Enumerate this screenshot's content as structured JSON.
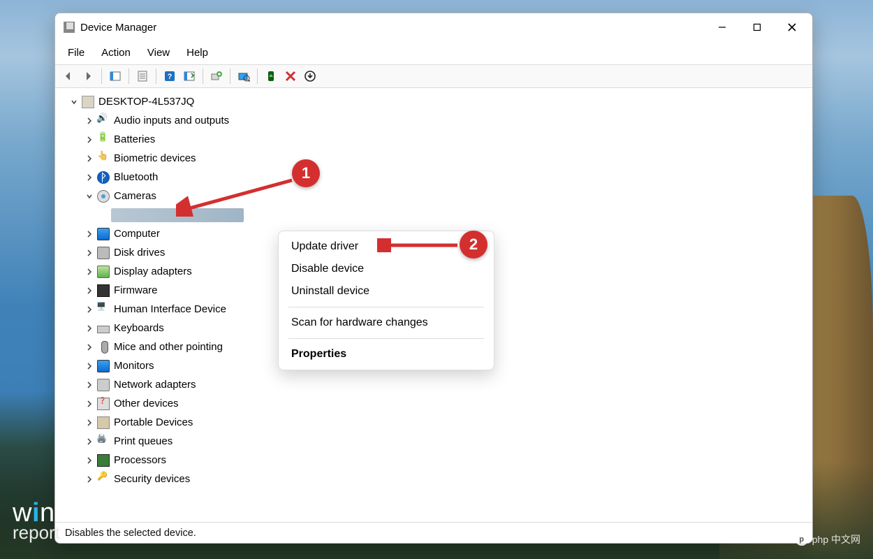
{
  "window": {
    "title": "Device Manager"
  },
  "window_controls": {
    "minimize": "Minimize",
    "maximize": "Maximize",
    "close": "Close"
  },
  "menubar": {
    "file": "File",
    "action": "Action",
    "view": "View",
    "help": "Help"
  },
  "toolbar": {
    "back": "Back",
    "forward": "Forward",
    "show_hidden": "Show hidden devices",
    "properties": "Properties",
    "help": "Help",
    "update": "Update driver",
    "uninstall_soft": "Add legacy hardware",
    "scan": "Scan for hardware changes",
    "enable": "Enable device",
    "disable": "Disable device",
    "uninstall": "Uninstall device"
  },
  "root": {
    "name": "DESKTOP-4L537JQ"
  },
  "categories": [
    {
      "label": "Audio inputs and outputs",
      "icon": "audio",
      "expanded": false
    },
    {
      "label": "Batteries",
      "icon": "battery",
      "expanded": false
    },
    {
      "label": "Biometric devices",
      "icon": "finger",
      "expanded": false
    },
    {
      "label": "Bluetooth",
      "icon": "bt",
      "expanded": false
    },
    {
      "label": "Cameras",
      "icon": "cam",
      "expanded": true
    },
    {
      "label": "Computer",
      "icon": "computer",
      "expanded": false
    },
    {
      "label": "Disk drives",
      "icon": "disk",
      "expanded": false
    },
    {
      "label": "Display adapters",
      "icon": "display",
      "expanded": false
    },
    {
      "label": "Firmware",
      "icon": "firmware",
      "expanded": false
    },
    {
      "label": "Human Interface Device",
      "icon": "hid",
      "expanded": false
    },
    {
      "label": "Keyboards",
      "icon": "kb",
      "expanded": false
    },
    {
      "label": "Mice and other pointing",
      "icon": "mouse",
      "expanded": false
    },
    {
      "label": "Monitors",
      "icon": "monitor",
      "expanded": false
    },
    {
      "label": "Network adapters",
      "icon": "net",
      "expanded": false
    },
    {
      "label": "Other devices",
      "icon": "other",
      "expanded": false
    },
    {
      "label": "Portable Devices",
      "icon": "portable",
      "expanded": false
    },
    {
      "label": "Print queues",
      "icon": "print",
      "expanded": false
    },
    {
      "label": "Processors",
      "icon": "cpu",
      "expanded": false
    },
    {
      "label": "Security devices",
      "icon": "security",
      "expanded": false
    }
  ],
  "context_menu": {
    "update": "Update driver",
    "disable": "Disable device",
    "uninstall": "Uninstall device",
    "scan": "Scan for hardware changes",
    "properties": "Properties"
  },
  "statusbar": {
    "text": "Disables the selected device."
  },
  "callouts": {
    "one": "1",
    "two": "2"
  },
  "watermark_left": {
    "l1a": "w",
    "l1b": "i",
    "l1c": "ndows",
    "l2": "report"
  },
  "watermark_right": {
    "text": "php 中文网"
  }
}
